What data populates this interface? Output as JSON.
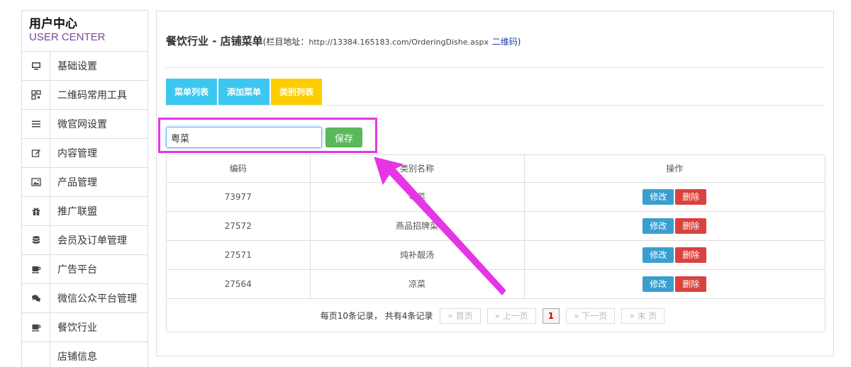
{
  "sidebar": {
    "title": "用户中心",
    "subtitle": "USER CENTER",
    "items": [
      {
        "label": "基础设置",
        "icon": "monitor-icon"
      },
      {
        "label": "二维码常用工具",
        "icon": "qrcode-icon"
      },
      {
        "label": "微官网设置",
        "icon": "menu-icon"
      },
      {
        "label": "内容管理",
        "icon": "edit-icon"
      },
      {
        "label": "产品管理",
        "icon": "image-icon"
      },
      {
        "label": "推广联盟",
        "icon": "gift-icon"
      },
      {
        "label": "会员及订单管理",
        "icon": "database-icon"
      },
      {
        "label": "广告平台",
        "icon": "coffee-icon"
      },
      {
        "label": "微信公众平台管理",
        "icon": "chat-icon"
      },
      {
        "label": "餐饮行业",
        "icon": "coffee-icon"
      },
      {
        "label": "店铺信息",
        "icon": ""
      }
    ]
  },
  "header": {
    "title": "餐饮行业 - 店铺菜单",
    "addr_prefix": "(栏目地址：",
    "url": "http://13384.165183.com/OrderingDishe.aspx",
    "qr_link": "二维码",
    "addr_suffix": ")"
  },
  "tabs": [
    {
      "label": "菜单列表",
      "color": "#3cc7f0"
    },
    {
      "label": "添加菜单",
      "color": "#3cc7f0"
    },
    {
      "label": "类别列表",
      "color": "#ffcc00",
      "active": true
    }
  ],
  "form": {
    "category_value": "粤菜",
    "save_label": "保存"
  },
  "table": {
    "headers": [
      "编码",
      "类别名称",
      "操作"
    ],
    "rows": [
      {
        "code": "73977",
        "name": "粤菜"
      },
      {
        "code": "27572",
        "name": "燕品招牌菜"
      },
      {
        "code": "27571",
        "name": "炖补靓汤"
      },
      {
        "code": "27564",
        "name": "凉菜"
      }
    ],
    "edit_label": "修改",
    "delete_label": "删除"
  },
  "pager": {
    "text": "每页10条记录， 共有4条记录",
    "first": "» 首页",
    "prev": "» 上一页",
    "current": "1",
    "next": "» 下一页",
    "last": "» 末 页"
  },
  "colors": {
    "annotation": "#e535e5",
    "save_button": "#5cb85c",
    "edit_button": "#3a9fcf",
    "delete_button": "#d9423e"
  }
}
